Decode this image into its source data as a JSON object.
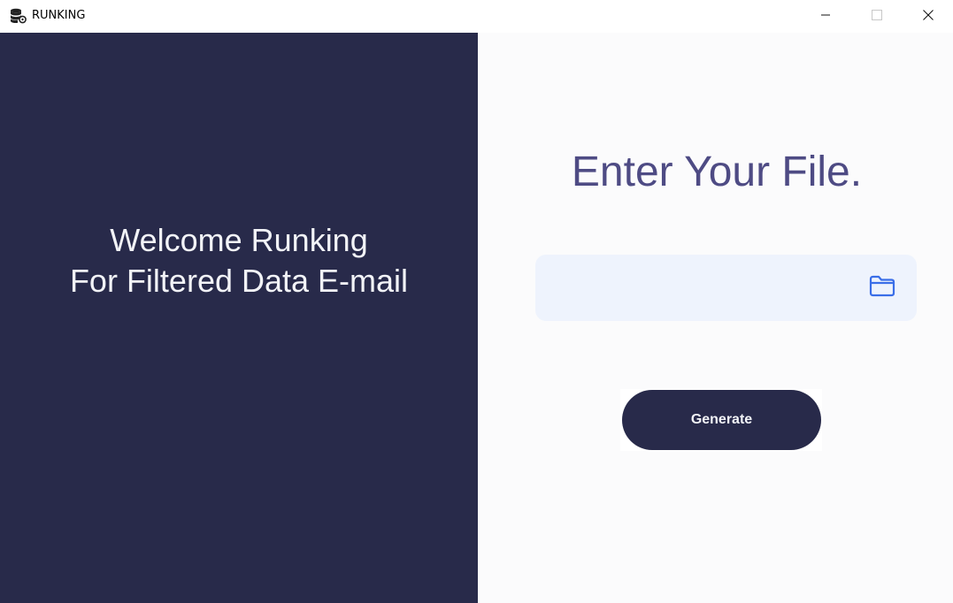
{
  "window": {
    "title": "RUNKING",
    "app_icon": "database-gear-icon",
    "controls": {
      "minimize_icon": "minimize-icon",
      "maximize_icon": "maximize-icon",
      "close_icon": "close-icon"
    }
  },
  "left_panel": {
    "welcome_line1": "Welcome Runking",
    "welcome_line2": "For Filtered Data E-mail"
  },
  "right_panel": {
    "heading": "Enter Your File.",
    "file_input": {
      "value": "",
      "placeholder": "",
      "browse_icon": "folder-icon"
    },
    "generate_label": "Generate"
  },
  "colors": {
    "left_background": "#282a4a",
    "right_background": "#fbfbfc",
    "heading_color": "#4e4b84",
    "input_background": "#eef3fd",
    "folder_icon_color": "#3a6ee8",
    "button_background": "#282a4a",
    "button_text": "#f2f3f7"
  }
}
